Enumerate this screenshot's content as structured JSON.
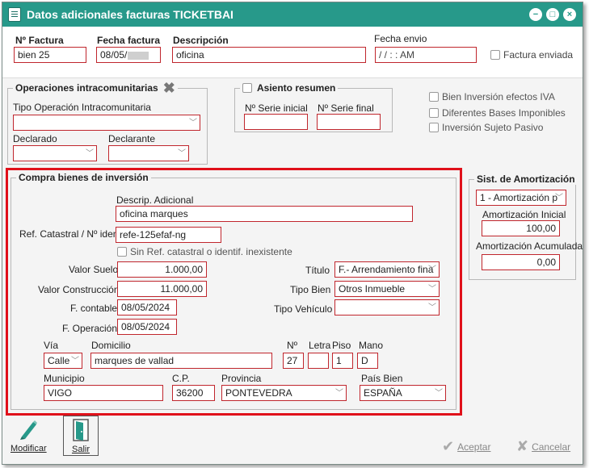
{
  "window": {
    "title": "Datos adicionales facturas TICKETBAI",
    "btn_min": "−",
    "btn_max": "□",
    "btn_close": "×"
  },
  "header": {
    "factura_label": "Nº Factura",
    "factura_value": "bien 25",
    "fecha_label": "Fecha factura",
    "fecha_value": "08/05/",
    "desc_label": "Descripción",
    "desc_value": "oficina",
    "envio_label": "Fecha envio",
    "envio_value": "/ /   : :  AM",
    "enviada_label": "Factura enviada"
  },
  "intra": {
    "title": "Operaciones intracomunitarias",
    "tipo_label": "Tipo Operación Intracomunitaria",
    "tipo_value": "",
    "declarado_label": "Declarado",
    "declarado_value": "",
    "declarante_label": "Declarante",
    "declarante_value": ""
  },
  "asiento": {
    "title": "Asiento resumen",
    "inicial_label": "Nº Serie inicial",
    "inicial_value": "",
    "final_label": "Nº Serie final",
    "final_value": ""
  },
  "checks": {
    "bien_inversion": "Bien Inversión efectos IVA",
    "bases": "Diferentes Bases Imponibles",
    "sujeto_pasivo": "Inversión Sujeto Pasivo"
  },
  "compra": {
    "title": "Compra bienes de inversión",
    "descrip_label": "Descrip. Adicional",
    "descrip_value": "oficina marques",
    "ref_label": "Ref. Catastral / Nº ident.",
    "ref_value": "refe-125efaf-ng",
    "sin_ref_label": "Sin Ref. catastral o identif. inexistente",
    "suelo_label": "Valor Suelo",
    "suelo_value": "1.000,00",
    "construccion_label": "Valor Construcción",
    "construccion_value": "11.000,00",
    "contable_label": "F. contable",
    "contable_value": "08/05/2024",
    "operacion_label": "F. Operación",
    "operacion_value": "08/05/2024",
    "titulo_label": "Título",
    "titulo_value": "F.- Arrendamiento fina",
    "tipobien_label": "Tipo Bien",
    "tipobien_value": "Otros Inmueble",
    "vehiculo_label": "Tipo Vehículo",
    "vehiculo_value": "",
    "via_label": "Vía",
    "via_value": "Calle",
    "domicilio_label": "Domicilio",
    "domicilio_value": "marques de vallad",
    "num_label": "Nº",
    "num_value": "27",
    "letra_label": "Letra",
    "letra_value": "",
    "piso_label": "Piso",
    "piso_value": "1",
    "mano_label": "Mano",
    "mano_value": "D",
    "municipio_label": "Municipio",
    "municipio_value": "VIGO",
    "cp_label": "C.P.",
    "cp_value": "36200",
    "provincia_label": "Provincia",
    "provincia_value": "PONTEVEDRA",
    "pais_label": "País Bien",
    "pais_value": "ESPAÑA"
  },
  "amort": {
    "title": "Sist. de Amortización",
    "sistema_value": "1 - Amortización p",
    "inicial_label": "Amortización Inicial",
    "inicial_value": "100,00",
    "acumulada_label": "Amortización Acumulada",
    "acumulada_value": "0,00"
  },
  "toolbar": {
    "modificar": "Modificar",
    "salir": "Salir"
  },
  "footer": {
    "aceptar": "Aceptar",
    "cancelar": "Cancelar"
  },
  "colors": {
    "title_bar": "#27998a",
    "field_border": "#c0262d",
    "highlight": "#e0101a"
  }
}
